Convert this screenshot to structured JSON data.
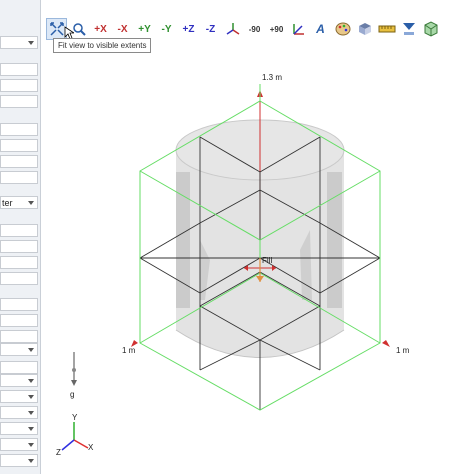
{
  "left_panel": {
    "visible_text": "ter"
  },
  "toolbar": {
    "buttons": [
      {
        "icon": "zoom-extents-icon",
        "label": ""
      },
      {
        "icon": "zoom-window-icon",
        "label": ""
      },
      {
        "icon": "view-plus-x-icon",
        "label": "+X"
      },
      {
        "icon": "view-minus-x-icon",
        "label": "-X"
      },
      {
        "icon": "view-plus-y-icon",
        "label": "+Y"
      },
      {
        "icon": "view-minus-y-icon",
        "label": "-Y"
      },
      {
        "icon": "view-plus-z-icon",
        "label": "+Z"
      },
      {
        "icon": "view-minus-z-icon",
        "label": "-Z"
      },
      {
        "icon": "view-isometric-icon",
        "label": ""
      },
      {
        "icon": "rotate-ccw-icon",
        "label": "-90"
      },
      {
        "icon": "rotate-cw-icon",
        "label": "+90"
      },
      {
        "icon": "axes-icon",
        "label": ""
      },
      {
        "icon": "font-icon",
        "label": "A"
      },
      {
        "icon": "palette-icon",
        "label": ""
      },
      {
        "icon": "projection-icon",
        "label": ""
      },
      {
        "icon": "ruler-icon",
        "label": ""
      },
      {
        "icon": "fill-icon",
        "label": ""
      },
      {
        "icon": "box-icon",
        "label": ""
      }
    ],
    "tooltip": "Fit view to visible extents"
  },
  "viewport": {
    "dim_top": "1.3 m",
    "dim_left": "1 m",
    "dim_right": "1 m",
    "fill_label": "Fill",
    "gravity_label": "g",
    "axis_x_label": "X",
    "axis_y_label": "Y",
    "axis_z_label": "Z",
    "colors": {
      "box_edges": "#66dd66",
      "inner_edges": "#333333",
      "dimension_line": "#d03030",
      "cylinder_fill": "#dadada",
      "axis_x": "#e03030",
      "axis_y": "#2fb02f",
      "axis_z": "#3030e0"
    }
  }
}
